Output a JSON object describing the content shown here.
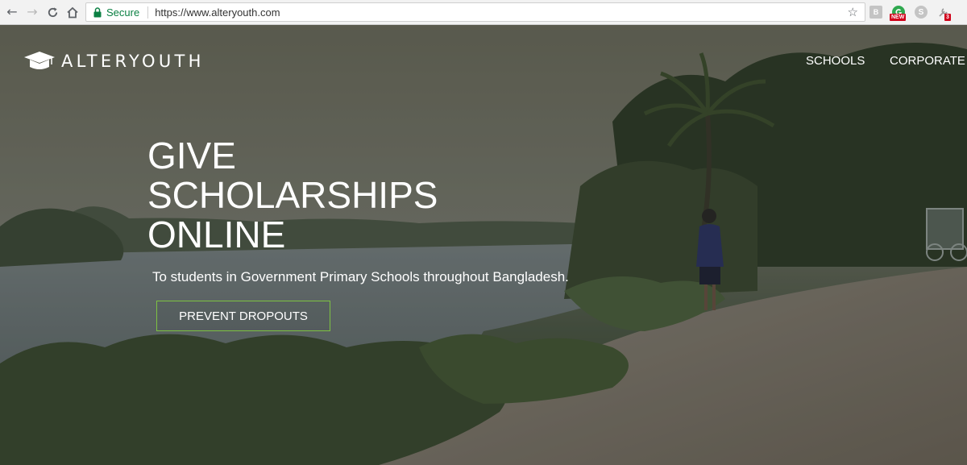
{
  "browser": {
    "secure_label": "Secure",
    "url": "https://www.alteryouth.com",
    "extensions": {
      "b_label": "B",
      "grammar_badge": "NEW",
      "tool_badge": "3"
    },
    "icons": [
      "back-icon",
      "forward-icon",
      "reload-icon",
      "home-icon",
      "lock-icon",
      "star-icon"
    ]
  },
  "header": {
    "brand_name": "ALTERYOUTH",
    "nav": {
      "schools": "SCHOOLS",
      "corporate": "CORPORATE"
    }
  },
  "hero": {
    "headline_line1": "GIVE",
    "headline_line2": "SCHOLARSHIPS",
    "headline_line3": "ONLINE",
    "subheadline": "To students in Government Primary Schools throughout Bangladesh.",
    "cta_label": "PREVENT DROPOUTS"
  },
  "colors": {
    "accent": "#7dc242",
    "secure_green": "#0b8043",
    "badge_red": "#d0021b"
  }
}
